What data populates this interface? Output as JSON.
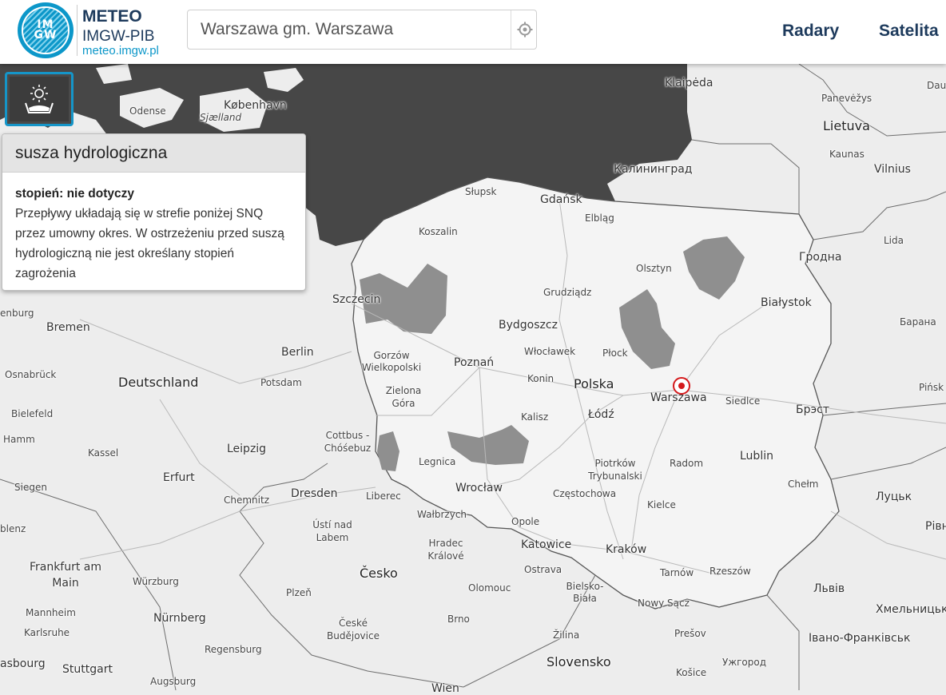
{
  "header": {
    "logo_text_line1": "IM",
    "logo_text_line2": "GW",
    "brand_line1": "METEO",
    "brand_line2": "IMGW-PIB",
    "brand_line3": "meteo.imgw.pl",
    "search_value": "Warszawa gm. Warszawa",
    "locate_icon": "locate-target-icon",
    "nav": [
      {
        "label": "Radary"
      },
      {
        "label": "Satelita"
      }
    ]
  },
  "layer_button": {
    "icon": "sun-drought-icon"
  },
  "popup": {
    "title": "susza hydrologiczna",
    "level": "stopień: nie dotyczy",
    "description": "Przepływy układają się w strefie poniżej SNQ przez umowny okres. W ostrzeżeniu przed suszą hydrologiczną nie jest określany stopień zagrożenia"
  },
  "map": {
    "colors": {
      "land": "#ededed",
      "sea": "#474747",
      "poland": "#f4f4f4",
      "warning_area": "#8f8f8f",
      "marker": "#d4191b"
    },
    "marker_icon": "location-marker-icon",
    "labels": [
      {
        "text": "Klaipėda"
      },
      {
        "text": "Panevėžys"
      },
      {
        "text": "Lietuva"
      },
      {
        "text": "Kaunas"
      },
      {
        "text": "Vilnius"
      },
      {
        "text": "Lida"
      },
      {
        "text": "Гродна"
      },
      {
        "text": "Калининград"
      },
      {
        "text": "Odense"
      },
      {
        "text": "København"
      },
      {
        "text": "Sjælland"
      },
      {
        "text": "Słupsk"
      },
      {
        "text": "Gdańsk"
      },
      {
        "text": "Elbląg"
      },
      {
        "text": "Koszalin"
      },
      {
        "text": "Olsztyn"
      },
      {
        "text": "Grudziądz"
      },
      {
        "text": "Szczecin"
      },
      {
        "text": "Białystok"
      },
      {
        "text": "Bydgoszcz"
      },
      {
        "text": "Bremen"
      },
      {
        "text": "Berlin"
      },
      {
        "text": "Gorzów Wielkopolski"
      },
      {
        "text": "Włocławek"
      },
      {
        "text": "Płock"
      },
      {
        "text": "Poznań"
      },
      {
        "text": "Osnabrück"
      },
      {
        "text": "Deutschland"
      },
      {
        "text": "Potsdam"
      },
      {
        "text": "Konin"
      },
      {
        "text": "Polska"
      },
      {
        "text": "Warszawa"
      },
      {
        "text": "Siedlce"
      },
      {
        "text": "Брэст"
      },
      {
        "text": "Zielona Góra"
      },
      {
        "text": "Kalisz"
      },
      {
        "text": "Łódź"
      },
      {
        "text": "Bielefeld"
      },
      {
        "text": "Hamm"
      },
      {
        "text": "Cottbus - Chóśebuz"
      },
      {
        "text": "Kassel"
      },
      {
        "text": "Leipzig"
      },
      {
        "text": "Legnica"
      },
      {
        "text": "Piotrków Trybunalski"
      },
      {
        "text": "Radom"
      },
      {
        "text": "Lublin"
      },
      {
        "text": "Erfurt"
      },
      {
        "text": "Siegen"
      },
      {
        "text": "Dresden"
      },
      {
        "text": "Liberec"
      },
      {
        "text": "Wrocław"
      },
      {
        "text": "Częstochowa"
      },
      {
        "text": "Chełm"
      },
      {
        "text": "Луцьк"
      },
      {
        "text": "Chemnitz"
      },
      {
        "text": "Wałbrzych"
      },
      {
        "text": "Kielce"
      },
      {
        "text": "Ústí nad Labem"
      },
      {
        "text": "Opole"
      },
      {
        "text": "Hradec Králové"
      },
      {
        "text": "Katowice"
      },
      {
        "text": "Kraków"
      },
      {
        "text": "Frankfurt am Main"
      },
      {
        "text": "Würzburg"
      },
      {
        "text": "Česko"
      },
      {
        "text": "Ostrava"
      },
      {
        "text": "Tarnów"
      },
      {
        "text": "Rzeszów"
      },
      {
        "text": "Львів"
      },
      {
        "text": "Plzeň"
      },
      {
        "text": "Olomouc"
      },
      {
        "text": "Bielsko-Biała"
      },
      {
        "text": "Nowy Sącz"
      },
      {
        "text": "Mannheim"
      },
      {
        "text": "Nürnberg"
      },
      {
        "text": "Brno"
      },
      {
        "text": "České Budějovice"
      },
      {
        "text": "Karlsruhe"
      },
      {
        "text": "Žilina"
      },
      {
        "text": "Prešov"
      },
      {
        "text": "Хмельницьк"
      },
      {
        "text": "Івано-Франківськ"
      },
      {
        "text": "Regensburg"
      },
      {
        "text": "Stuttgart"
      },
      {
        "text": "Slovensko"
      },
      {
        "text": "Košice"
      },
      {
        "text": "Ужгород"
      },
      {
        "text": "Augsburg"
      },
      {
        "text": "Wien"
      },
      {
        "text": "Барана"
      },
      {
        "text": "Pińsk"
      },
      {
        "text": "Рівн"
      },
      {
        "text": "enburg"
      },
      {
        "text": "blenz"
      },
      {
        "text": "asbourg"
      },
      {
        "text": "Dau"
      }
    ]
  }
}
